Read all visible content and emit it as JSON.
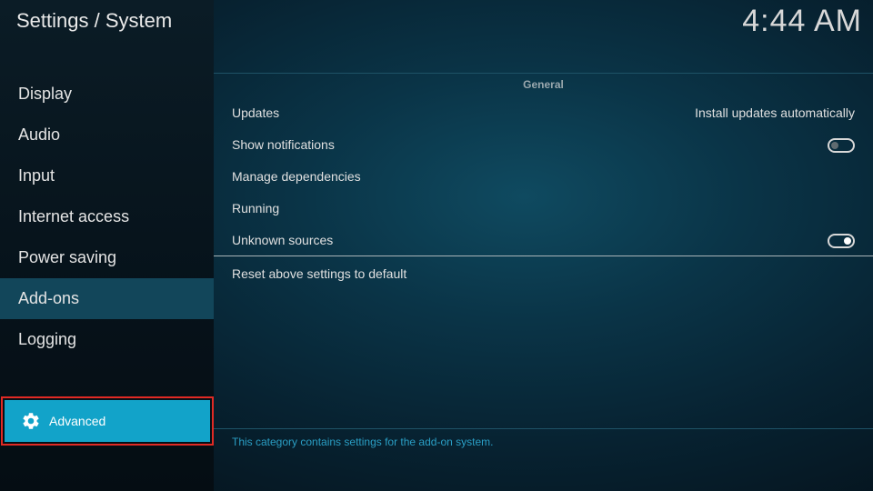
{
  "header": {
    "title": "Settings / System",
    "clock": "4:44 AM"
  },
  "sidebar": {
    "items": [
      {
        "label": "Display"
      },
      {
        "label": "Audio"
      },
      {
        "label": "Input"
      },
      {
        "label": "Internet access"
      },
      {
        "label": "Power saving"
      },
      {
        "label": "Add-ons",
        "active": true
      },
      {
        "label": "Logging"
      }
    ],
    "level_button": {
      "label": "Advanced",
      "icon": "gear-icon"
    }
  },
  "main": {
    "section_header": "General",
    "settings": [
      {
        "label": "Updates",
        "value": "Install updates automatically"
      },
      {
        "label": "Show notifications",
        "toggle": "off"
      },
      {
        "label": "Manage dependencies"
      },
      {
        "label": "Running"
      },
      {
        "label": "Unknown sources",
        "toggle": "on"
      }
    ],
    "reset_label": "Reset above settings to default",
    "description": "This category contains settings for the add-on system."
  },
  "colors": {
    "accent": "#12a3c9",
    "active_bg": "#12465a",
    "highlight_border": "#e02a24",
    "description_text": "#2a9ec4"
  }
}
